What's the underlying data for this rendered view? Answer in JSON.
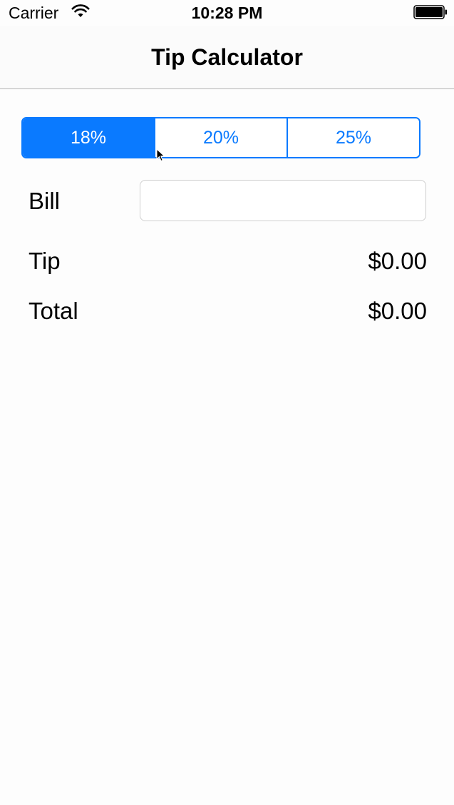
{
  "status_bar": {
    "carrier": "Carrier",
    "time": "10:28 PM",
    "wifi_icon": "wifi-icon",
    "battery_icon": "battery-full-icon"
  },
  "nav": {
    "title": "Tip Calculator"
  },
  "tip_selector": {
    "segments": [
      "18%",
      "20%",
      "25%"
    ],
    "selected": "18%"
  },
  "bill": {
    "label": "Bill",
    "value": "",
    "placeholder": ""
  },
  "tip": {
    "label": "Tip",
    "value": "$0.00"
  },
  "total": {
    "label": "Total",
    "value": "$0.00"
  },
  "colors": {
    "accent": "#0a7aff",
    "background": "#fdfdfd",
    "separator": "#b2b2b2"
  }
}
